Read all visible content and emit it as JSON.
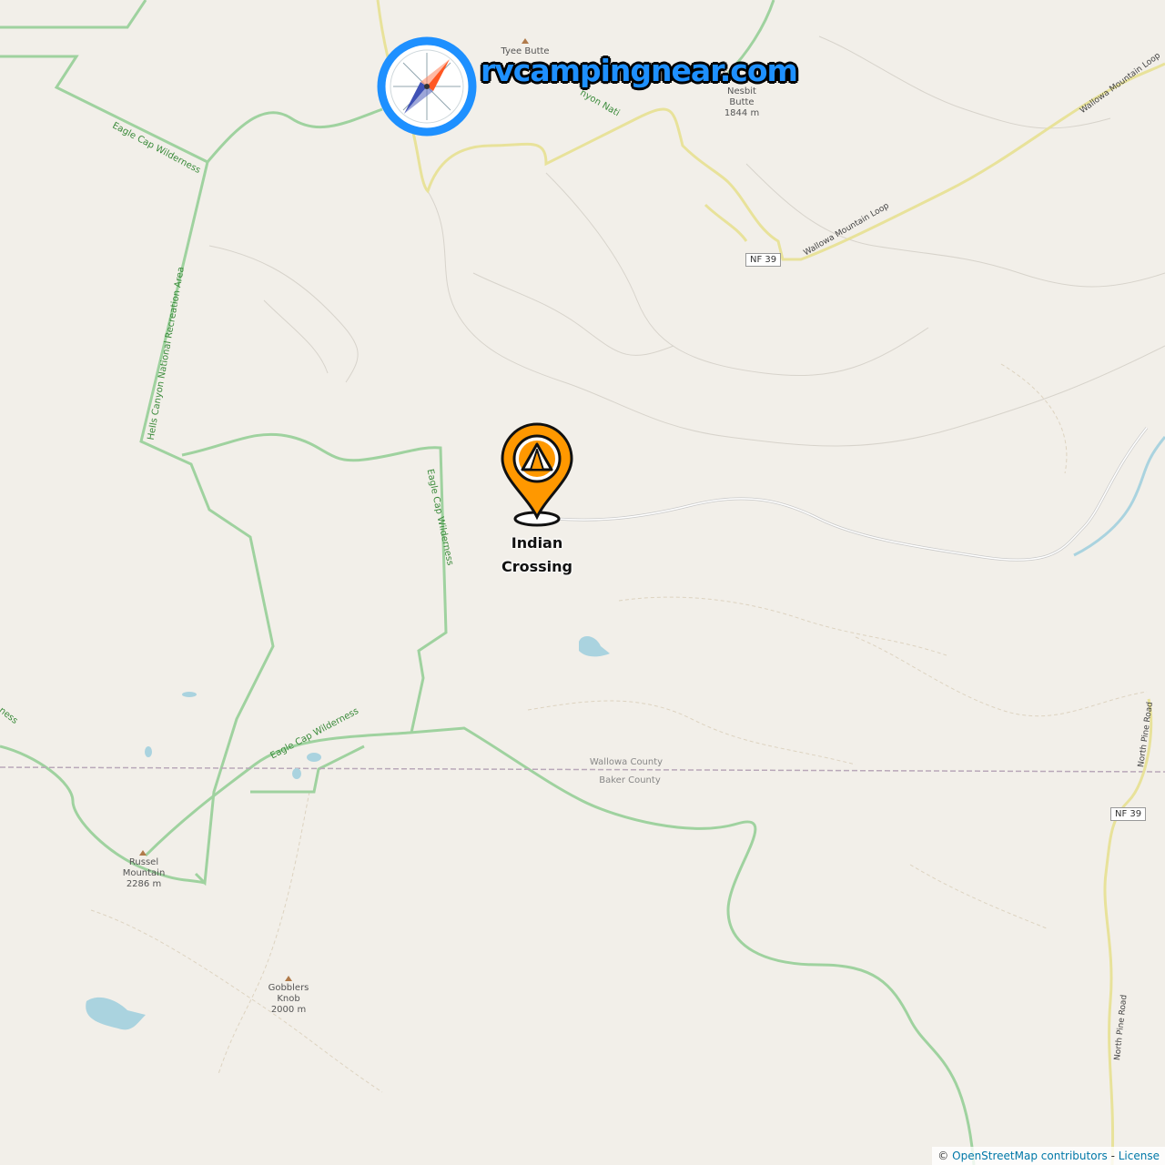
{
  "brand": {
    "name": "rvcampingnear.com"
  },
  "marker": {
    "name": "Indian\nCrossing",
    "icon": "campsite-marker-icon",
    "color": "#ff9800"
  },
  "peaks": [
    {
      "id": "tyee",
      "label": "Tyee Butte"
    },
    {
      "id": "nesbit",
      "label": "Nesbit\nButte\n1844 m"
    },
    {
      "id": "russel",
      "label": "Russel\nMountain\n2286 m"
    },
    {
      "id": "gobblers",
      "label": "Gobblers\nKnob\n2000 m"
    }
  ],
  "areas": {
    "eagle_cap_1": "Eagle Cap Wilderness",
    "eagle_cap_2": "Eagle Cap Wilderness",
    "eagle_cap_3": "Eagle Cap Wilderness",
    "eagle_cap_4": "ness",
    "hells_canyon": "Hells Canyon National Recreation Area",
    "hells_canyon_top": "nyon Nati"
  },
  "roads": {
    "wallowa_loop_1": "Wallowa Mountain Loop",
    "wallowa_loop_2": "Wallowa Mountain Loop",
    "north_pine_1": "North Pine Road",
    "north_pine_2": "North Pine Road",
    "nf39_1": "NF 39",
    "nf39_2": "NF 39"
  },
  "counties": {
    "north": "Wallowa County",
    "south": "Baker County"
  },
  "attribution": {
    "prefix": "©",
    "osm": "OpenStreetMap contributors",
    "sep": "-",
    "license": "License"
  },
  "colors": {
    "background": "#f2efe9",
    "boundary": "#9fd29f",
    "road": "#f7f7a8",
    "water": "#aad3df",
    "brand": "#1e90ff"
  }
}
